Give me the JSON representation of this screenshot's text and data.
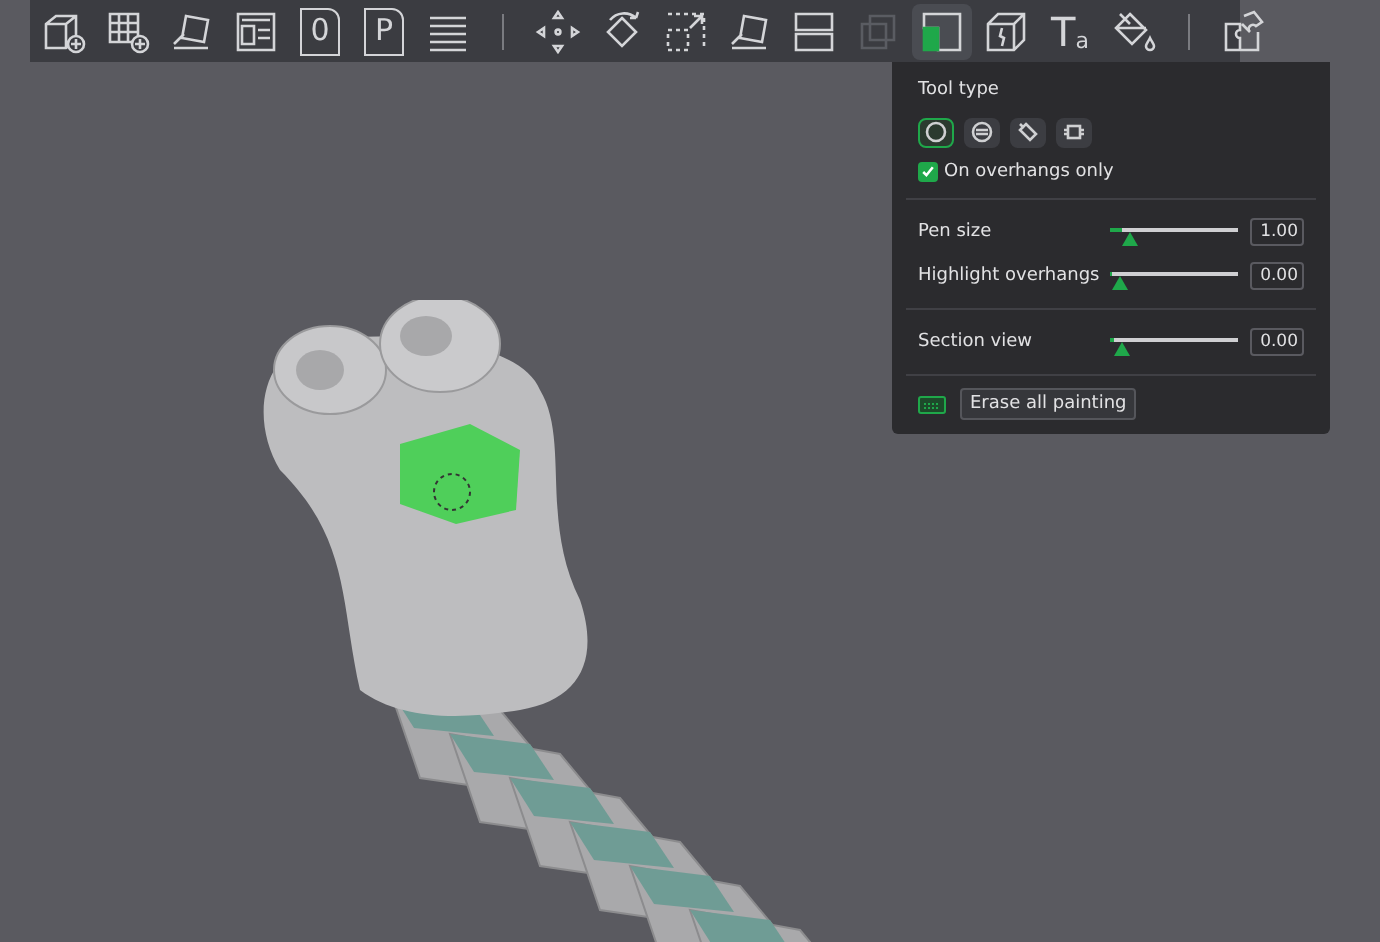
{
  "toolbar": {
    "groups": [
      [
        {
          "selected": false,
          "disabled": false
        },
        {
          "selected": false,
          "disabled": false
        },
        {
          "selected": false,
          "disabled": false
        },
        {
          "selected": false,
          "disabled": false
        },
        {
          "selected": false,
          "disabled": false,
          "glyph": "0"
        },
        {
          "selected": false,
          "disabled": false,
          "glyph": "P"
        },
        {
          "selected": false,
          "disabled": false
        }
      ],
      [
        {
          "selected": false,
          "disabled": false
        },
        {
          "selected": false,
          "disabled": false
        },
        {
          "selected": false,
          "disabled": false
        },
        {
          "selected": false,
          "disabled": false
        },
        {
          "selected": false,
          "disabled": false
        },
        {
          "selected": false,
          "disabled": true
        },
        {
          "selected": true,
          "disabled": false
        },
        {
          "selected": false,
          "disabled": false
        },
        {
          "selected": false,
          "disabled": false,
          "glyph": "T",
          "glyph2": "a"
        },
        {
          "selected": false,
          "disabled": false
        }
      ],
      [
        {
          "selected": false,
          "disabled": false
        }
      ]
    ]
  },
  "panel": {
    "tool_type_label": "Tool type",
    "tool_types": [
      {
        "selected": true
      },
      {
        "selected": false
      },
      {
        "selected": false
      },
      {
        "selected": false
      }
    ],
    "overhangs_only": {
      "label": "On overhangs only",
      "checked": true
    },
    "slider_groups": [
      [
        {
          "label": "Pen size",
          "level": 0.1,
          "value": "1.00"
        },
        {
          "label": "Highlight overhangs",
          "level": 0.02,
          "value": "0.00"
        }
      ],
      [
        {
          "label": "Section view",
          "level": 0.03,
          "value": "0.00"
        }
      ]
    ],
    "erase_button": "Erase all painting"
  }
}
